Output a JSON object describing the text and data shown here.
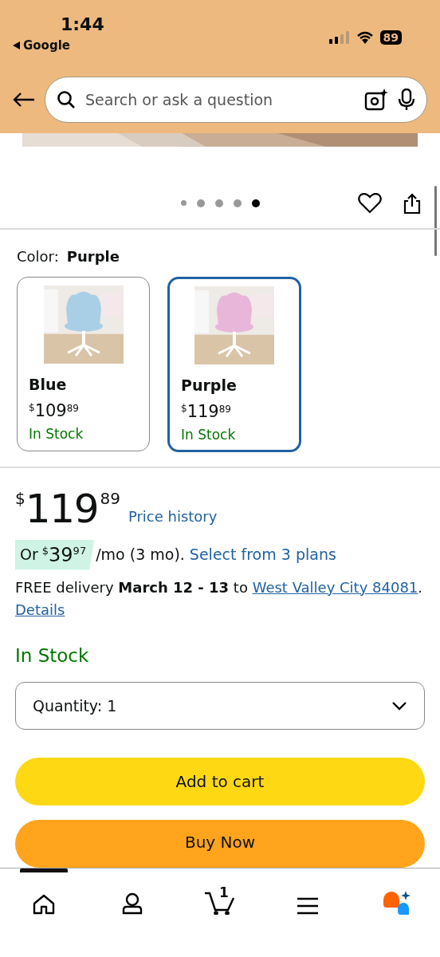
{
  "status_bar": {
    "time": "1:44",
    "back_app": "Google",
    "battery": "89"
  },
  "search": {
    "placeholder": "Search or ask a question"
  },
  "gallery": {
    "dots": [
      {
        "selected": false
      },
      {
        "selected": false
      },
      {
        "selected": false
      },
      {
        "selected": false
      },
      {
        "selected": true
      }
    ]
  },
  "color": {
    "label": "Color:",
    "value": "Purple",
    "options": [
      {
        "name": "Blue",
        "currency": "$",
        "whole": "109",
        "fraction": "89",
        "stock": "In Stock",
        "selected": false
      },
      {
        "name": "Purple",
        "currency": "$",
        "whole": "119",
        "fraction": "89",
        "stock": "In Stock",
        "selected": true
      }
    ]
  },
  "price": {
    "currency": "$",
    "whole": "119",
    "fraction": "89",
    "history_link": "Price history"
  },
  "installment": {
    "prefix": "Or",
    "currency": "$",
    "whole": "39",
    "fraction": "97",
    "term": "/mo (3 mo).",
    "link": "Select from 3 plans"
  },
  "delivery": {
    "text": "FREE delivery **March 12 - 13** to",
    "location_link": "West Valley City 84081",
    "period": ".",
    "details_link": "Details"
  },
  "availability": "In Stock",
  "quantity": {
    "label": "Quantity: 1"
  },
  "buttons": [
    {
      "label": "Add to cart",
      "kind": "cart"
    },
    {
      "label": "Buy Now",
      "kind": "buy"
    }
  ],
  "bottom_nav": [
    {
      "kind": "home",
      "selected": true
    },
    {
      "kind": "account",
      "selected": false
    },
    {
      "kind": "cart",
      "badge": "1",
      "selected": false
    },
    {
      "kind": "menu",
      "selected": false
    },
    {
      "kind": "assistant",
      "selected": false
    }
  ]
}
